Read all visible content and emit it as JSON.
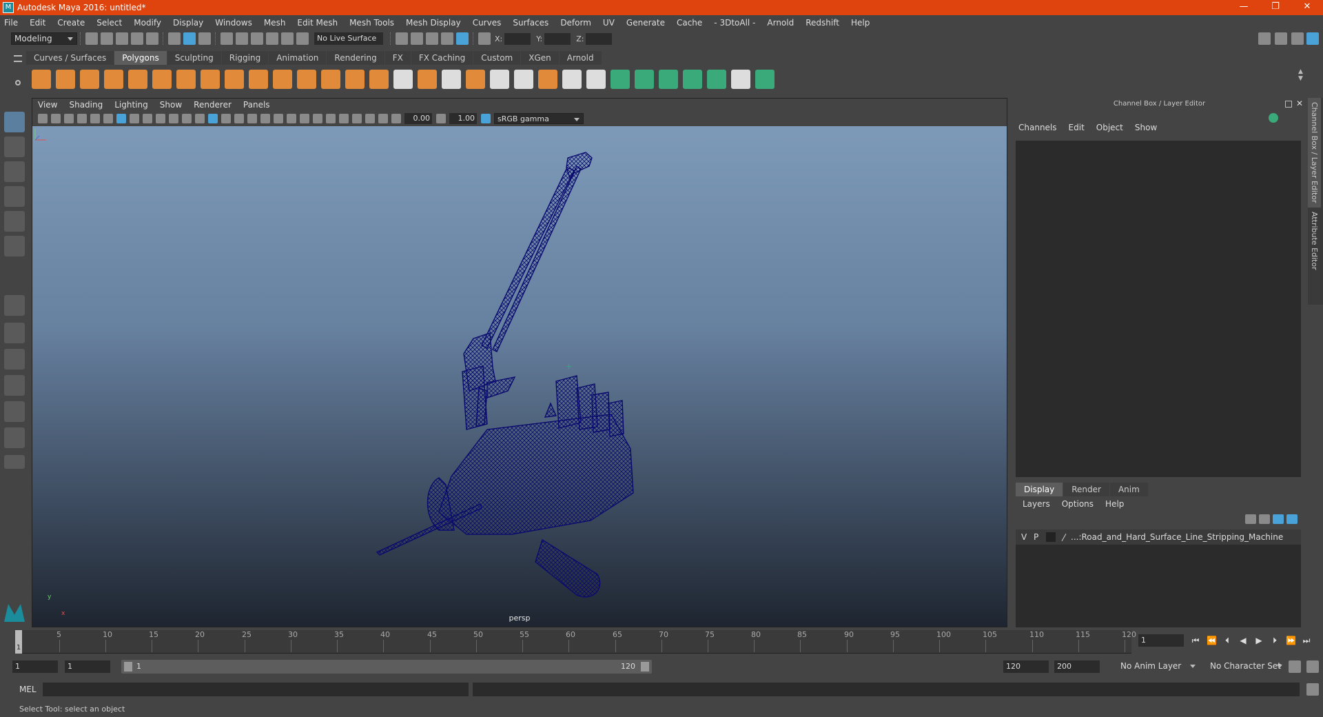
{
  "window": {
    "title": "Autodesk Maya 2016: untitled*",
    "minimize": "—",
    "restore": "❐",
    "close": "✕"
  },
  "menu": [
    "File",
    "Edit",
    "Create",
    "Select",
    "Modify",
    "Display",
    "Windows",
    "Mesh",
    "Edit Mesh",
    "Mesh Tools",
    "Mesh Display",
    "Curves",
    "Surfaces",
    "Deform",
    "UV",
    "Generate",
    "Cache",
    "- 3DtoAll -",
    "Arnold",
    "Redshift",
    "Help"
  ],
  "status": {
    "menuset": "Modeling",
    "live_surface": "No Live Surface",
    "x_label": "X:",
    "y_label": "Y:",
    "z_label": "Z:"
  },
  "shelf_tabs": [
    "Curves / Surfaces",
    "Polygons",
    "Sculpting",
    "Rigging",
    "Animation",
    "Rendering",
    "FX",
    "FX Caching",
    "Custom",
    "XGen",
    "Arnold"
  ],
  "shelf_active": "Polygons",
  "viewport": {
    "menu": [
      "View",
      "Shading",
      "Lighting",
      "Show",
      "Renderer",
      "Panels"
    ],
    "exposure": "0.00",
    "gamma": "1.00",
    "color_space": "sRGB gamma",
    "camera": "persp",
    "axis_y": "y",
    "axis_x": "x"
  },
  "channel_box": {
    "header": "Channel Box / Layer Editor",
    "menu": [
      "Channels",
      "Edit",
      "Object",
      "Show"
    ]
  },
  "layer_editor": {
    "tabs": [
      "Display",
      "Render",
      "Anim"
    ],
    "active_tab": "Display",
    "menu": [
      "Layers",
      "Options",
      "Help"
    ],
    "layers": [
      {
        "v": "V",
        "p": "P",
        "name": "...:Road_and_Hard_Surface_Line_Stripping_Machine"
      }
    ]
  },
  "side_tabs": [
    "Channel Box / Layer Editor",
    "Attribute Editor"
  ],
  "timeline": {
    "ticks": [
      "5",
      "10",
      "15",
      "20",
      "25",
      "30",
      "35",
      "40",
      "45",
      "50",
      "55",
      "60",
      "65",
      "70",
      "75",
      "80",
      "85",
      "90",
      "95",
      "100",
      "105",
      "110",
      "115",
      "120"
    ],
    "current_frame": "1",
    "current_field": "1"
  },
  "range": {
    "start": "1",
    "playback_start": "1",
    "slider_start": "1",
    "slider_end": "120",
    "playback_end": "120",
    "end": "200",
    "anim_layer": "No Anim Layer",
    "character_set": "No Character Set"
  },
  "command": {
    "lang": "MEL"
  },
  "help_line": "Select Tool: select an object",
  "colors": {
    "title_bar": "#e0440e",
    "accent": "#5b7f9f",
    "wireframe": "#0a0a6e"
  }
}
